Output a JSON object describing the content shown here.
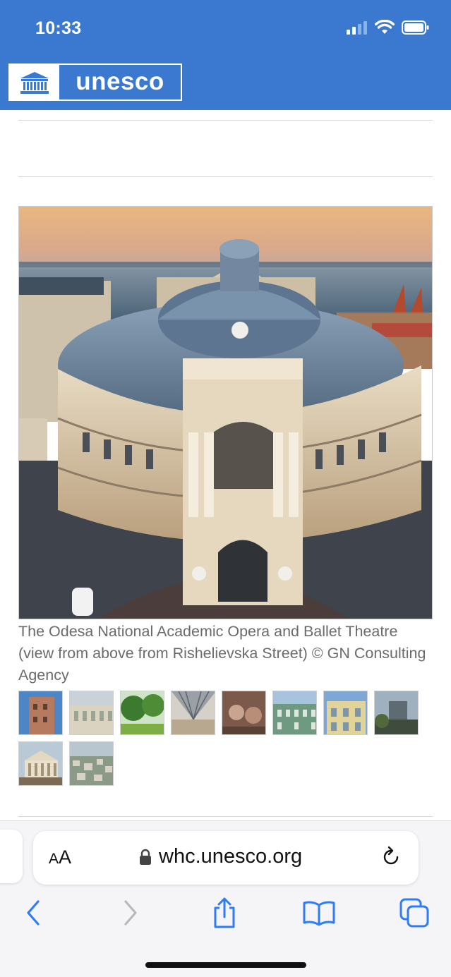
{
  "status_bar": {
    "time": "10:33"
  },
  "header": {
    "logo_text": "unesco",
    "brand_color": "#3a79cf"
  },
  "image": {
    "caption": "The Odesa National Academic Opera and Ballet Theatre (view from above from Rishelievska Street) © GN Consulting Agency"
  },
  "gallery": {
    "thumbnails": [
      "thumbnail-1",
      "thumbnail-2",
      "thumbnail-3",
      "thumbnail-4",
      "thumbnail-5",
      "thumbnail-6",
      "thumbnail-7",
      "thumbnail-8",
      "thumbnail-9",
      "thumbnail-10"
    ]
  },
  "browser": {
    "text_size_small": "A",
    "text_size_large": "A",
    "url": "whc.unesco.org",
    "icons": [
      "lock-icon",
      "reload-icon",
      "back-icon",
      "forward-icon",
      "share-icon",
      "bookmarks-icon",
      "tabs-icon"
    ],
    "accent_color": "#2f7cf6"
  }
}
